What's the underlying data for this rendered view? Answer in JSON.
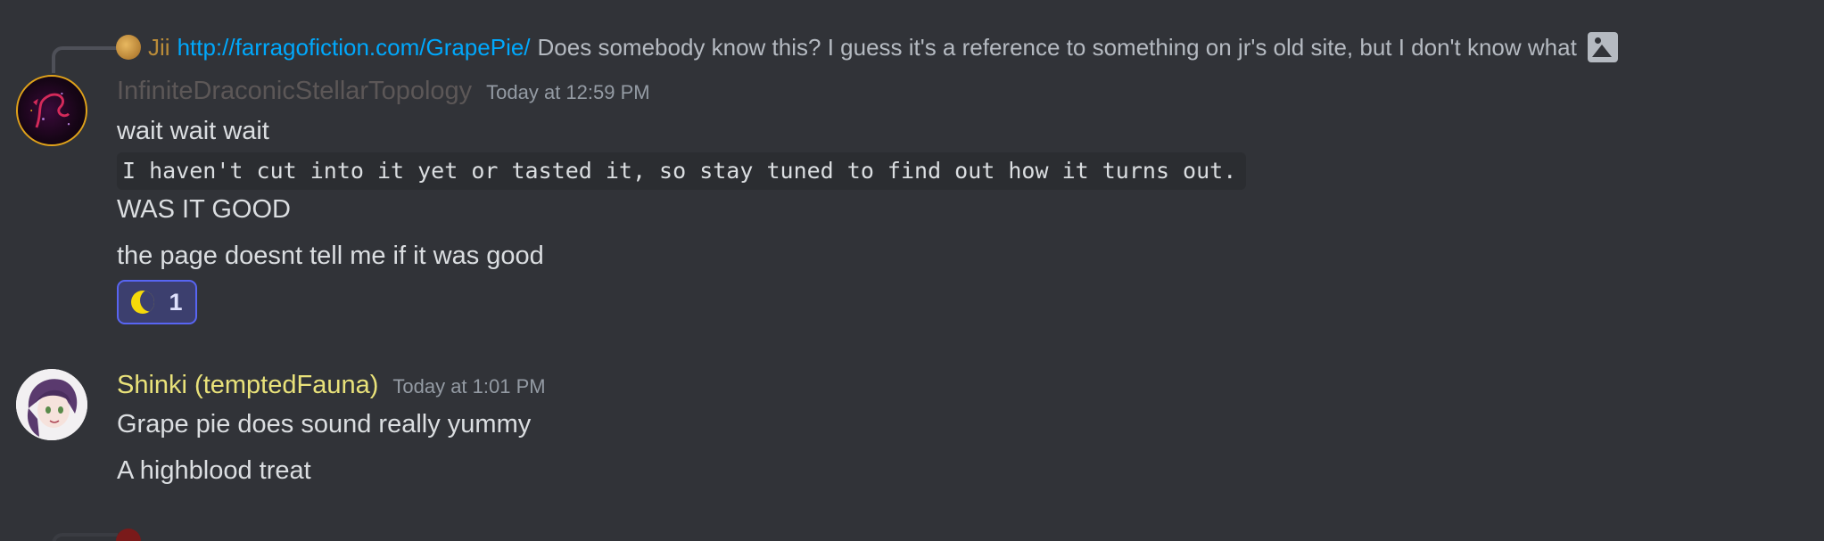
{
  "reply": {
    "author": "Jii",
    "link": "http://farragofiction.com/GrapePie/",
    "text": "Does somebody know this? I guess it's a reference to something on jr's old site, but I don't know what"
  },
  "message1": {
    "username": "InfiniteDraconicStellarTopology",
    "timestamp": "Today at 12:59 PM",
    "line1": "wait wait wait",
    "code": "I haven't cut into it yet or tasted it, so stay tuned to find out how it turns out.",
    "line2": "WAS IT GOOD",
    "line3": "the page doesnt tell me if it was good",
    "reaction": {
      "icon": "crescent-moon-icon",
      "count": "1"
    }
  },
  "message2": {
    "username": "Shinki (temptedFauna)",
    "timestamp": "Today at 1:01 PM",
    "line1": "Grape pie does sound really yummy",
    "line2": "A highblood treat"
  },
  "colors": {
    "background": "#313338",
    "link": "#00a8fc",
    "username2": "#e9e27a",
    "reaction_border": "#5865f2"
  }
}
